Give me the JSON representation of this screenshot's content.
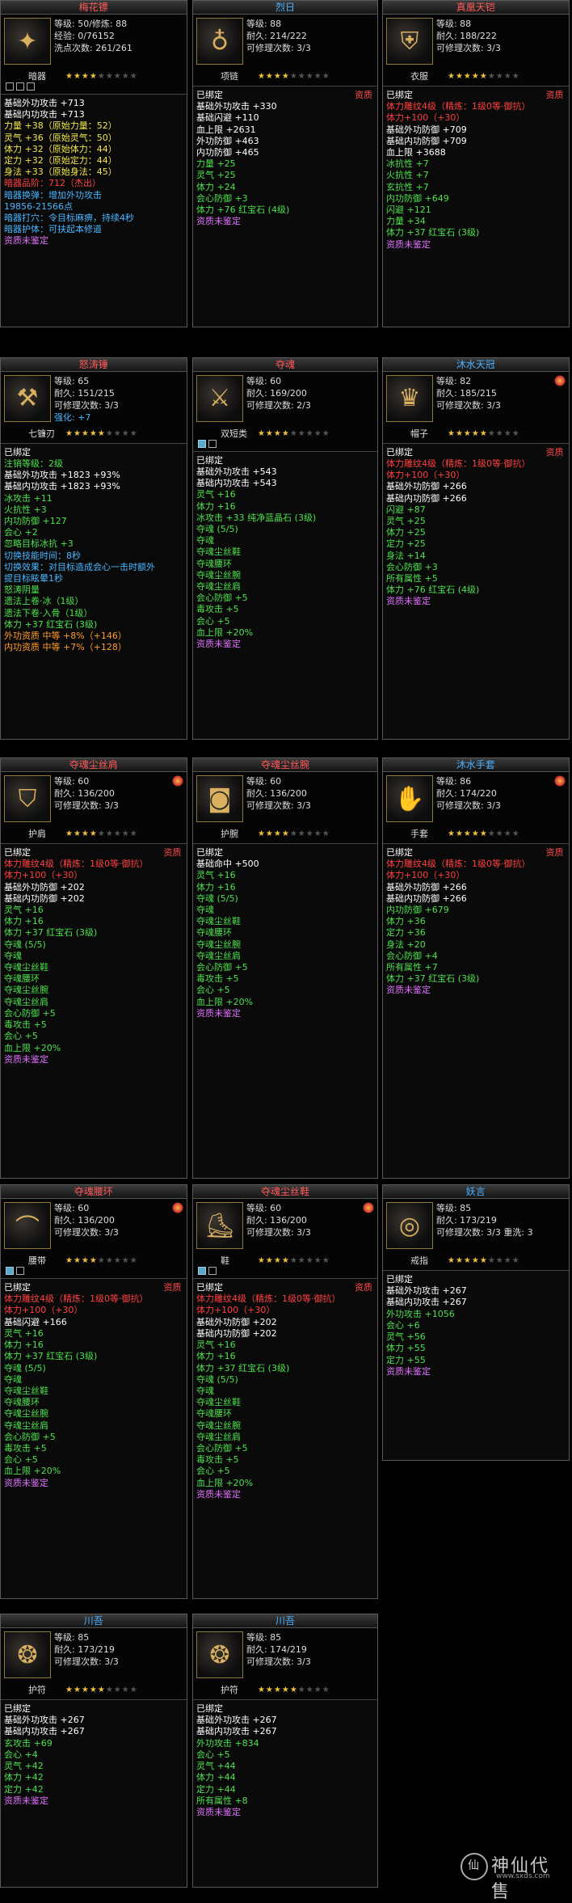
{
  "items": [
    {
      "title": "梅花镖",
      "title_color": "red",
      "icon": "dart-icon",
      "flame": false,
      "infos": [
        "等级: 50/修炼: 88",
        "经验: 0/76152",
        "洗点次数: 261/261"
      ],
      "type": "暗器",
      "stars": 4,
      "sockets": [
        false,
        false,
        false
      ],
      "attr": "",
      "lines": [
        [
          "w",
          "基础外功攻击 +713"
        ],
        [
          "w",
          "基础内功攻击 +713"
        ],
        [
          "y",
          "力量 +38（原始力量：52）"
        ],
        [
          "y",
          "灵气 +36（原始灵气：50）"
        ],
        [
          "y",
          "体力 +32（原始体力：44）"
        ],
        [
          "y",
          "定力 +32（原始定力：44）"
        ],
        [
          "y",
          "身法 +33（原始身法：45）"
        ],
        [
          "r",
          "暗器品阶：712（杰出）"
        ],
        [
          "c",
          "暗器换弹：增加外功攻击"
        ],
        [
          "c",
          "19856-21566点"
        ],
        [
          "c",
          "暗器打穴：令目标麻痹，持续4秒"
        ],
        [
          "c",
          "暗器护体：可扶起本修道"
        ],
        [
          "p",
          "资质未鉴定"
        ]
      ]
    },
    {
      "title": "烈日",
      "title_color": "blue",
      "icon": "amulet-icon",
      "flame": false,
      "infos": [
        "等级: 88",
        "耐久: 214/222",
        "可修理次数: 3/3"
      ],
      "type": "项链",
      "stars": 4,
      "sockets": [],
      "attr": "资质",
      "lines": [
        [
          "w",
          "已绑定"
        ],
        [
          "w",
          "基础外功攻击 +330"
        ],
        [
          "w",
          "基础闪避 +110"
        ],
        [
          "w",
          "血上限 +2631"
        ],
        [
          "w",
          "外功防御 +463"
        ],
        [
          "w",
          "内功防御 +465"
        ],
        [
          "g",
          "力量 +25"
        ],
        [
          "g",
          "灵气 +25"
        ],
        [
          "g",
          "体力 +24"
        ],
        [
          "g",
          "会心防御 +3"
        ],
        [
          "g",
          "体力 +76 红宝石 (4级)"
        ],
        [
          "p",
          "资质未鉴定"
        ]
      ]
    },
    {
      "title": "真凰天铠",
      "title_color": "red",
      "icon": "armor-icon",
      "flame": false,
      "infos": [
        "等级: 88",
        "耐久: 188/222",
        "可修理次数: 3/3"
      ],
      "type": "衣服",
      "stars": 5,
      "sockets": [],
      "attr": "资质",
      "lines": [
        [
          "w",
          "已绑定"
        ],
        [
          "r",
          "体力雕纹4级（精炼：1级0等·御抗）"
        ],
        [
          "r",
          "体力+100（+30）"
        ],
        [
          "w",
          "基础外功防御 +709"
        ],
        [
          "w",
          "基础内功防御 +709"
        ],
        [
          "w",
          "血上限 +3688"
        ],
        [
          "g",
          "冰抗性 +7"
        ],
        [
          "g",
          "火抗性 +7"
        ],
        [
          "g",
          "玄抗性 +7"
        ],
        [
          "g",
          "内功防御 +649"
        ],
        [
          "g",
          "闪避 +121"
        ],
        [
          "g",
          "力量 +34"
        ],
        [
          "g",
          "体力 +37 红宝石 (3级)"
        ],
        [
          "p",
          "资质未鉴定"
        ]
      ]
    },
    {
      "title": "怒涛锤",
      "title_color": "red",
      "icon": "hammer-icon",
      "flame": false,
      "infos": [
        "等级: 65",
        "耐久: 151/215",
        "可修理次数: 3/3",
        "强化: +7"
      ],
      "type": "七镰刃",
      "stars": 5,
      "sockets": [],
      "attr": "",
      "lines": [
        [
          "w",
          "已绑定"
        ],
        [
          "g",
          "注销等级：2级"
        ],
        [
          "w",
          "基础外功攻击 +1823 +93%"
        ],
        [
          "w",
          "基础内功攻击 +1823 +93%"
        ],
        [
          "g",
          "冰攻击 +11"
        ],
        [
          "g",
          "火抗性 +3"
        ],
        [
          "g",
          "内功防御 +127"
        ],
        [
          "g",
          "会心 +2"
        ],
        [
          "g",
          "忽略目标冰抗 +3"
        ],
        [
          "c",
          "切换技能时间：8秒"
        ],
        [
          "c",
          "切换效果：对目标造成会心一击时额外"
        ],
        [
          "c",
          "提目标眩晕1秒"
        ],
        [
          "g",
          "怒涛阴量"
        ],
        [
          "g",
          "遗法上卷·冰（1级）"
        ],
        [
          "g",
          "遗法下卷·入骨（1级）"
        ],
        [
          "g",
          "体力 +37 红宝石 (3级)"
        ],
        [
          "o",
          "外功资质   中等 +8%（+146）"
        ],
        [
          "o",
          "内功资质   中等 +7%（+128）"
        ]
      ]
    },
    {
      "title": "夺魂",
      "title_color": "red",
      "icon": "saber-icon",
      "flame": false,
      "infos": [
        "等级: 60",
        "耐久: 169/200",
        "可修理次数: 2/3"
      ],
      "type": "双短类",
      "stars": 4,
      "sockets": [
        true,
        false
      ],
      "attr": "",
      "lines": [
        [
          "w",
          "已绑定"
        ],
        [
          "w",
          "基础外功攻击 +543"
        ],
        [
          "w",
          "基础内功攻击 +543"
        ],
        [
          "g",
          "灵气 +16"
        ],
        [
          "g",
          "体力 +16"
        ],
        [
          "g",
          "冰攻击 +33 纯净蓝晶石 (3级)"
        ],
        [
          "g",
          "夺魂      (5/5)"
        ],
        [
          "g",
          "夺魂"
        ],
        [
          "g",
          "夺魂尘丝鞋"
        ],
        [
          "g",
          "夺魂腰环"
        ],
        [
          "g",
          "夺魂尘丝腕"
        ],
        [
          "g",
          "夺魂尘丝肩"
        ],
        [
          "g",
          "会心防御 +5"
        ],
        [
          "g",
          "毒攻击 +5"
        ],
        [
          "g",
          "会心 +5"
        ],
        [
          "g",
          "血上限 +20%"
        ],
        [
          "p",
          "资质未鉴定"
        ]
      ]
    },
    {
      "title": "沐水天冠",
      "title_color": "blue",
      "icon": "helmet-icon",
      "flame": true,
      "infos": [
        "等级: 82",
        "耐久: 185/215",
        "可修理次数: 3/3"
      ],
      "type": "帽子",
      "stars": 5,
      "sockets": [],
      "attr": "资质",
      "lines": [
        [
          "w",
          "已绑定"
        ],
        [
          "r",
          "体力雕纹4级（精炼：1级0等·御抗）"
        ],
        [
          "r",
          "体力+100（+30）"
        ],
        [
          "w",
          "基础外功防御 +266"
        ],
        [
          "w",
          "基础内功防御 +266"
        ],
        [
          "g",
          "闪避 +87"
        ],
        [
          "g",
          "灵气 +25"
        ],
        [
          "g",
          "体力 +25"
        ],
        [
          "g",
          "定力 +25"
        ],
        [
          "g",
          "身法 +14"
        ],
        [
          "g",
          "会心防御 +3"
        ],
        [
          "g",
          "所有属性 +5"
        ],
        [
          "g",
          "体力 +76 红宝石 (4级)"
        ],
        [
          "p",
          "资质未鉴定"
        ]
      ]
    },
    {
      "title": "夺魂尘丝肩",
      "title_color": "red",
      "icon": "shoulder-icon",
      "flame": true,
      "infos": [
        "等级: 60",
        "耐久: 136/200",
        "可修理次数: 3/3"
      ],
      "type": "护肩",
      "stars": 4,
      "sockets": [],
      "attr": "资质",
      "lines": [
        [
          "w",
          "已绑定"
        ],
        [
          "r",
          "体力雕纹4级（精炼：1级0等·御抗）"
        ],
        [
          "r",
          "体力+100（+30）"
        ],
        [
          "w",
          "基础外功防御 +202"
        ],
        [
          "w",
          "基础内功防御 +202"
        ],
        [
          "g",
          "灵气 +16"
        ],
        [
          "g",
          "体力 +16"
        ],
        [
          "g",
          "体力 +37 红宝石 (3级)"
        ],
        [
          "g",
          "夺魂      (5/5)"
        ],
        [
          "g",
          "夺魂"
        ],
        [
          "g",
          "夺魂尘丝鞋"
        ],
        [
          "g",
          "夺魂腰环"
        ],
        [
          "g",
          "夺魂尘丝腕"
        ],
        [
          "g",
          "夺魂尘丝肩"
        ],
        [
          "g",
          "会心防御 +5"
        ],
        [
          "g",
          "毒攻击 +5"
        ],
        [
          "g",
          "会心 +5"
        ],
        [
          "g",
          "血上限 +20%"
        ],
        [
          "p",
          "资质未鉴定"
        ]
      ]
    },
    {
      "title": "夺魂尘丝腕",
      "title_color": "red",
      "icon": "bracer-icon",
      "flame": false,
      "infos": [
        "等级: 60",
        "耐久: 136/200",
        "可修理次数: 3/3"
      ],
      "type": "护腕",
      "stars": 4,
      "sockets": [],
      "attr": "",
      "lines": [
        [
          "w",
          "已绑定"
        ],
        [
          "w",
          "基础命中 +500"
        ],
        [
          "g",
          "灵气 +16"
        ],
        [
          "g",
          "体力 +16"
        ],
        [
          "g",
          "夺魂      (5/5)"
        ],
        [
          "g",
          "夺魂"
        ],
        [
          "g",
          "夺魂尘丝鞋"
        ],
        [
          "g",
          "夺魂腰环"
        ],
        [
          "g",
          "夺魂尘丝腕"
        ],
        [
          "g",
          "夺魂尘丝肩"
        ],
        [
          "g",
          "会心防御 +5"
        ],
        [
          "g",
          "毒攻击 +5"
        ],
        [
          "g",
          "会心 +5"
        ],
        [
          "g",
          "血上限 +20%"
        ],
        [
          "p",
          "资质未鉴定"
        ]
      ]
    },
    {
      "title": "沐水手套",
      "title_color": "blue",
      "icon": "glove-icon",
      "flame": true,
      "infos": [
        "等级: 86",
        "耐久: 174/220",
        "可修理次数: 3/3"
      ],
      "type": "手套",
      "stars": 5,
      "sockets": [],
      "attr": "资质",
      "lines": [
        [
          "w",
          "已绑定"
        ],
        [
          "r",
          "体力雕纹4级（精炼：1级0等·御抗）"
        ],
        [
          "r",
          "体力+100（+30）"
        ],
        [
          "w",
          "基础外功防御 +266"
        ],
        [
          "w",
          "基础内功防御 +266"
        ],
        [
          "g",
          "内功防御 +679"
        ],
        [
          "g",
          "体力 +36"
        ],
        [
          "g",
          "定力 +36"
        ],
        [
          "g",
          "身法 +20"
        ],
        [
          "g",
          "会心防御 +4"
        ],
        [
          "g",
          "所有属性 +7"
        ],
        [
          "g",
          "体力 +37 红宝石 (3级)"
        ],
        [
          "p",
          "资质未鉴定"
        ]
      ]
    },
    {
      "title": "夺魂腰环",
      "title_color": "red",
      "icon": "belt-icon",
      "flame": true,
      "infos": [
        "等级: 60",
        "耐久: 136/200",
        "可修理次数: 3/3"
      ],
      "type": "腰带",
      "stars": 4,
      "sockets": [
        true,
        false
      ],
      "attr": "资质",
      "lines": [
        [
          "w",
          "已绑定"
        ],
        [
          "r",
          "体力雕纹4级（精炼：1级0等·御抗）"
        ],
        [
          "r",
          "体力+100（+30）"
        ],
        [
          "w",
          "基础闪避 +166"
        ],
        [
          "g",
          "灵气 +16"
        ],
        [
          "g",
          "体力 +16"
        ],
        [
          "g",
          "体力 +37 红宝石 (3级)"
        ],
        [
          "g",
          "夺魂      (5/5)"
        ],
        [
          "g",
          "夺魂"
        ],
        [
          "g",
          "夺魂尘丝鞋"
        ],
        [
          "g",
          "夺魂腰环"
        ],
        [
          "g",
          "夺魂尘丝腕"
        ],
        [
          "g",
          "夺魂尘丝肩"
        ],
        [
          "g",
          "会心防御 +5"
        ],
        [
          "g",
          "毒攻击 +5"
        ],
        [
          "g",
          "会心 +5"
        ],
        [
          "g",
          "血上限 +20%"
        ],
        [
          "p",
          "资质未鉴定"
        ]
      ]
    },
    {
      "title": "夺魂尘丝鞋",
      "title_color": "red",
      "icon": "boots-icon",
      "flame": true,
      "infos": [
        "等级: 60",
        "耐久: 136/200",
        "可修理次数: 3/3"
      ],
      "type": "鞋",
      "stars": 4,
      "sockets": [
        true,
        false
      ],
      "attr": "资质",
      "lines": [
        [
          "w",
          "已绑定"
        ],
        [
          "r",
          "体力雕纹4级（精炼：1级0等·御抗）"
        ],
        [
          "r",
          "体力+100（+30）"
        ],
        [
          "w",
          "基础外功防御 +202"
        ],
        [
          "w",
          "基础内功防御 +202"
        ],
        [
          "g",
          "灵气 +16"
        ],
        [
          "g",
          "体力 +16"
        ],
        [
          "g",
          "体力 +37 红宝石 (3级)"
        ],
        [
          "g",
          "夺魂      (5/5)"
        ],
        [
          "g",
          "夺魂"
        ],
        [
          "g",
          "夺魂尘丝鞋"
        ],
        [
          "g",
          "夺魂腰环"
        ],
        [
          "g",
          "夺魂尘丝腕"
        ],
        [
          "g",
          "夺魂尘丝肩"
        ],
        [
          "g",
          "会心防御 +5"
        ],
        [
          "g",
          "毒攻击 +5"
        ],
        [
          "g",
          "会心 +5"
        ],
        [
          "g",
          "血上限 +20%"
        ],
        [
          "p",
          "资质未鉴定"
        ]
      ]
    },
    {
      "title": "妖言",
      "title_color": "blue",
      "icon": "ring-icon",
      "flame": false,
      "infos": [
        "等级: 85",
        "耐久: 173/219",
        "可修理次数: 3/3   重洗: 3"
      ],
      "type": "戒指",
      "stars": 5,
      "sockets": [],
      "attr": "",
      "lines": [
        [
          "w",
          "已绑定"
        ],
        [
          "w",
          "基础外功攻击 +267"
        ],
        [
          "w",
          "基础内功攻击 +267"
        ],
        [
          "g",
          "外功攻击 +1056"
        ],
        [
          "g",
          "会心 +6"
        ],
        [
          "g",
          "灵气 +56"
        ],
        [
          "g",
          "体力 +55"
        ],
        [
          "g",
          "定力 +55"
        ],
        [
          "p",
          "资质未鉴定"
        ]
      ]
    },
    {
      "title": "川吾",
      "title_color": "blue",
      "icon": "talisman-icon",
      "flame": false,
      "infos": [
        "等级: 85",
        "耐久: 173/219",
        "可修理次数: 3/3"
      ],
      "type": "护符",
      "stars": 5,
      "sockets": [],
      "attr": "",
      "lines": [
        [
          "w",
          "已绑定"
        ],
        [
          "w",
          "基础外功攻击 +267"
        ],
        [
          "w",
          "基础内功攻击 +267"
        ],
        [
          "g",
          "玄攻击 +69"
        ],
        [
          "g",
          "会心 +4"
        ],
        [
          "g",
          "灵气 +42"
        ],
        [
          "g",
          "体力 +42"
        ],
        [
          "g",
          "定力 +42"
        ],
        [
          "p",
          "资质未鉴定"
        ]
      ]
    },
    {
      "title": "川吾",
      "title_color": "blue",
      "icon": "talisman-icon",
      "flame": false,
      "infos": [
        "等级: 85",
        "耐久: 174/219",
        "可修理次数: 3/3"
      ],
      "type": "护符",
      "stars": 5,
      "sockets": [],
      "attr": "",
      "lines": [
        [
          "w",
          "已绑定"
        ],
        [
          "w",
          "基础外功攻击 +267"
        ],
        [
          "w",
          "基础内功攻击 +267"
        ],
        [
          "g",
          "外功攻击 +834"
        ],
        [
          "g",
          "会心 +5"
        ],
        [
          "g",
          "灵气 +44"
        ],
        [
          "g",
          "体力 +44"
        ],
        [
          "g",
          "定力 +44"
        ],
        [
          "g",
          "所有属性 +8"
        ],
        [
          "p",
          "资质未鉴定"
        ]
      ]
    }
  ],
  "watermark": {
    "text": "神仙代售",
    "url": "www.sxds.com"
  }
}
